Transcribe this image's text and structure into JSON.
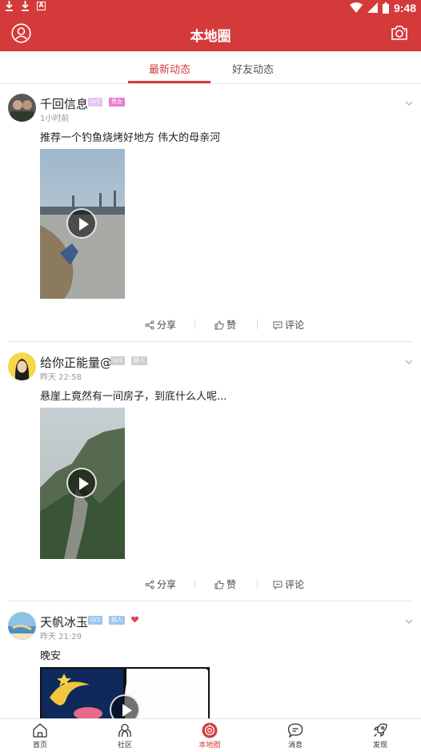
{
  "status_bar": {
    "time": "9:48"
  },
  "header": {
    "title": "本地圈"
  },
  "tabs": [
    {
      "label": "最新动态",
      "active": true
    },
    {
      "label": "好友动态",
      "active": false
    }
  ],
  "posts": [
    {
      "username": "千回信息",
      "level": "LV1",
      "tag": "秀女",
      "time": "1小时前",
      "text": "推荐一个钓鱼烧烤好地方 伟大的母亲河",
      "media": "video"
    },
    {
      "username": "给你正能量@",
      "level": "LV1",
      "tag": "路人",
      "time": "昨天 22:58",
      "text": "悬崖上竟然有一间房子，到底什么人呢...",
      "media": "video"
    },
    {
      "username": "天帆冰玉",
      "level": "LV1",
      "tag": "路人",
      "time": "昨天 21:29",
      "text": "晚安",
      "media": "video"
    }
  ],
  "actions": {
    "share": "分享",
    "like": "赞",
    "comment": "评论"
  },
  "bottom_nav": [
    {
      "label": "首页",
      "icon": "home-icon",
      "active": false
    },
    {
      "label": "社区",
      "icon": "community-icon",
      "active": false
    },
    {
      "label": "本地圈",
      "icon": "local-circle-icon",
      "active": true
    },
    {
      "label": "消息",
      "icon": "message-icon",
      "active": false
    },
    {
      "label": "发现",
      "icon": "rocket-icon",
      "active": false
    }
  ],
  "colors": {
    "brand": "#d53a3a",
    "level_badge": "#e2b8f0",
    "tag_badge": "#e77dd0"
  }
}
